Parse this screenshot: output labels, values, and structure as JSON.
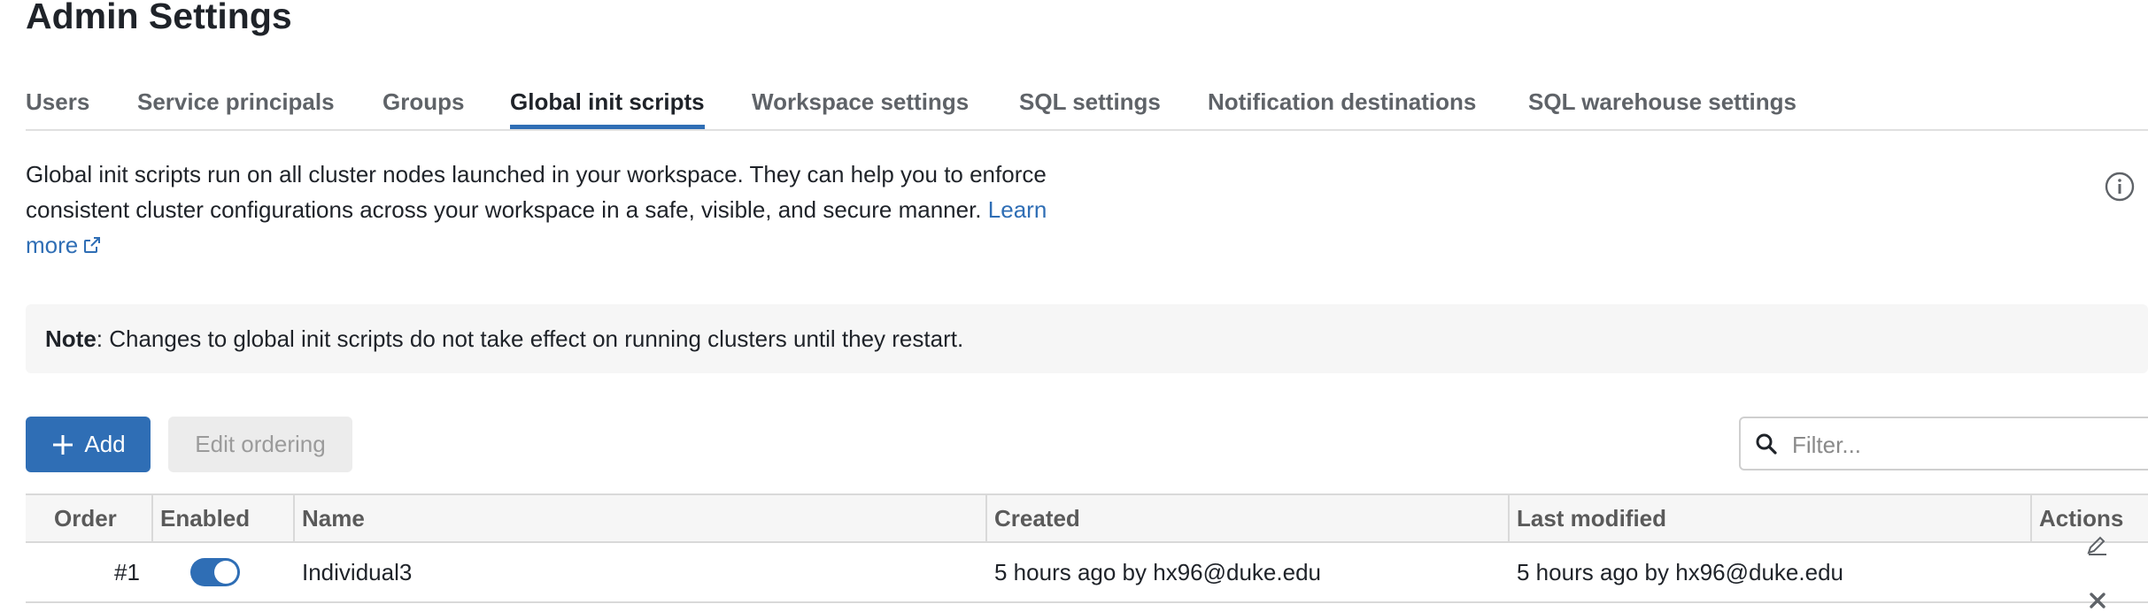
{
  "page": {
    "title": "Admin Settings"
  },
  "tabs": [
    {
      "label": "Users",
      "active": false
    },
    {
      "label": "Service principals",
      "active": false
    },
    {
      "label": "Groups",
      "active": false
    },
    {
      "label": "Global init scripts",
      "active": true
    },
    {
      "label": "Workspace settings",
      "active": false
    },
    {
      "label": "SQL settings",
      "active": false
    },
    {
      "label": "Notification destinations",
      "active": false
    },
    {
      "label": "SQL warehouse settings",
      "active": false
    }
  ],
  "description": {
    "text": "Global init scripts run on all cluster nodes launched in your workspace. They can help you to enforce consistent cluster configurations across your workspace in a safe, visible, and secure manner.",
    "link_label": "Learn more",
    "link_icon": "external-link-icon",
    "info_icon": "info-icon"
  },
  "note": {
    "label": "Note",
    "text": ": Changes to global init scripts do not take effect on running clusters until they restart."
  },
  "toolbar": {
    "add_label": "Add",
    "add_icon": "plus-icon",
    "edit_ordering_label": "Edit ordering",
    "filter_placeholder": "Filter...",
    "filter_icon": "search-icon"
  },
  "table": {
    "columns": [
      "Order",
      "Enabled",
      "Name",
      "Created",
      "Last modified",
      "Actions"
    ],
    "rows": [
      {
        "order": "#1",
        "enabled": true,
        "name": "Individual3",
        "created": "5 hours ago by hx96@duke.edu",
        "last_modified": "5 hours ago by hx96@duke.edu",
        "actions": [
          "edit-icon",
          "delete-icon"
        ]
      }
    ]
  },
  "colors": {
    "accent": "#2f6eb5",
    "text": "#1f2329",
    "muted_text": "#5f6368",
    "note_background": "#f6f6f6",
    "disabled_button": "#ececec"
  }
}
